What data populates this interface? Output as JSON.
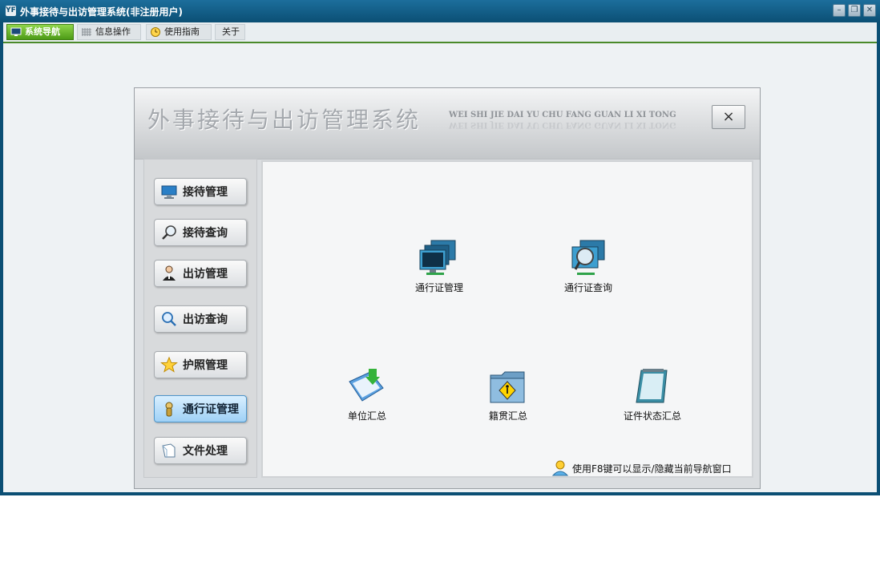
{
  "window": {
    "title": "外事接待与出访管理系统(非注册用户)",
    "app_icon_text": "YF"
  },
  "tabs": [
    {
      "label": "系统导航",
      "active": true,
      "icon": "monitor-icon"
    },
    {
      "label": "信息操作",
      "active": false,
      "icon": "grid-icon"
    },
    {
      "label": "使用指南",
      "active": false,
      "icon": "clock-icon"
    },
    {
      "label": "关于",
      "active": false,
      "icon": ""
    }
  ],
  "panel": {
    "title": "外事接待与出访管理系统",
    "pinyin": "WEI SHI JIE DAI YU CHU FANG GUAN  LI  XI  TONG",
    "close_label": "×"
  },
  "nav": [
    {
      "label": "接待管理",
      "icon": "monitor-icon",
      "active": false
    },
    {
      "label": "接待查询",
      "icon": "magnifier-icon",
      "active": false
    },
    {
      "label": "出访管理",
      "icon": "person-icon",
      "active": false
    },
    {
      "label": "出访查询",
      "icon": "search-icon",
      "active": false
    },
    {
      "label": "护照管理",
      "icon": "star-icon",
      "active": false
    },
    {
      "label": "通行证管理",
      "icon": "badge-icon",
      "active": true
    },
    {
      "label": "文件处理",
      "icon": "document-icon",
      "active": false
    }
  ],
  "content": {
    "items": [
      {
        "label": "通行证管理",
        "icon": "computer-network-icon"
      },
      {
        "label": "通行证查询",
        "icon": "computer-search-icon"
      },
      {
        "label": "单位汇总",
        "icon": "download-doc-icon"
      },
      {
        "label": "籍贯汇总",
        "icon": "folder-pedestrian-icon"
      },
      {
        "label": "证件状态汇总",
        "icon": "notepad-icon"
      }
    ],
    "hint": "使用F8键可以显示/隐藏当前导航窗口"
  }
}
